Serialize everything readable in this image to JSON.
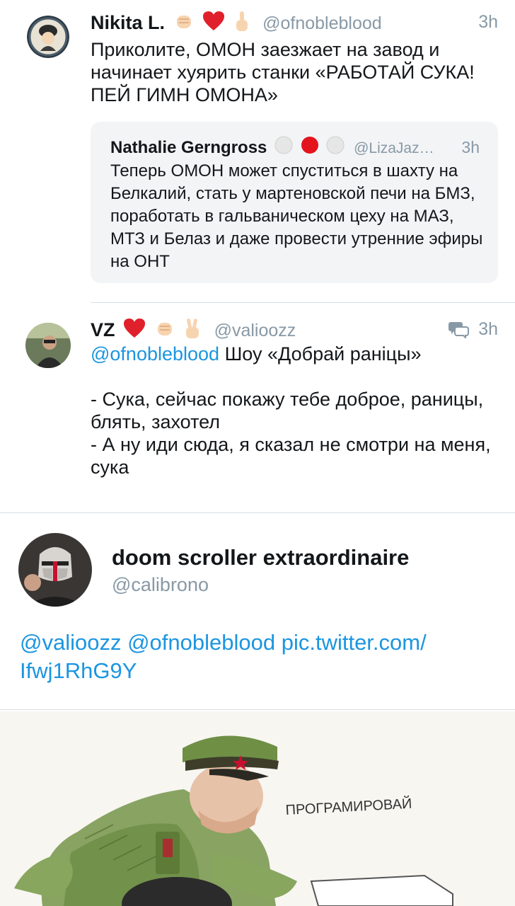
{
  "tweets": [
    {
      "name": "Nikita L.",
      "handle": "@ofnobleblood",
      "time": "3h",
      "text": "Приколите, ОМОН заезжает на завод и начинает хуярить станки «РАБОТАЙ СУКА! ПЕЙ ГИМН ОМОНА»",
      "emojis": [
        "fist-light-emoji",
        "heart-emoji",
        "middle-finger-emoji"
      ],
      "quote": {
        "name": "Nathalie Gerngross",
        "handle": "@LizaJaz…",
        "time": "3h",
        "text": "Теперь ОМОН может спуститься в шахту на Белкалий, стать  у мартеновской печи на БМЗ, поработать в гальваническом цеху на МАЗ, МТЗ и Белаз и даже провести утренние эфиры на ОНТ",
        "emojis": [
          "white-circle-emoji",
          "red-circle-emoji",
          "white-circle-emoji"
        ]
      }
    },
    {
      "name": "VZ",
      "handle": "@valioozz",
      "time": "3h",
      "mention": "@ofnobleblood",
      "text_first": " Шоу «Добрай раніцы»",
      "line2": "- Сука, сейчас покажу тебе доброе, раницы, блять, захотел",
      "line3": "- А ну иди сюда, я сказал не смотри на меня, сука",
      "icon": "conversation-icon",
      "emojis": [
        "heart-emoji",
        "fist-light-emoji",
        "victory-hand-emoji"
      ]
    },
    {
      "name": "doom scroller extraordinaire",
      "handle": "@calibrono",
      "text": "@valioozz @ofnobleblood pic.twitter.com/ Ifwj1RhG9Y"
    }
  ],
  "image": {
    "caption": "ПРОГРАМИРОВАЙ"
  },
  "colors": {
    "link": "#1b95e0",
    "secondary": "#8899a6",
    "quote_bg": "#f3f4f6"
  }
}
